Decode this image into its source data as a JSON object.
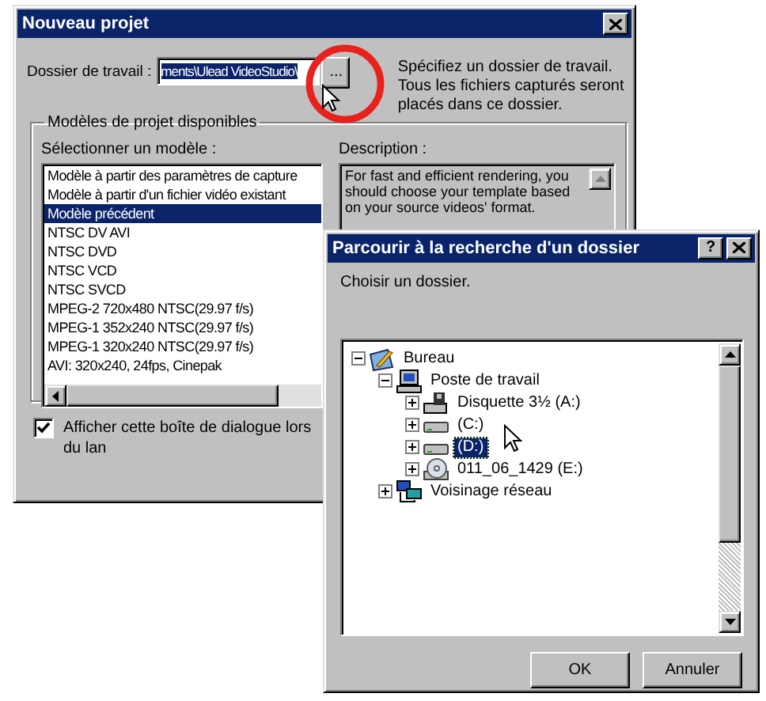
{
  "project_dialog": {
    "title": "Nouveau projet",
    "folder_label": "Dossier de travail :",
    "folder_value": "ments\\Ulead VideoStudio\\",
    "folder_value_selected": true,
    "browse_button": "...",
    "folder_hint": "Spécifiez un dossier de travail. Tous les fichiers capturés seront placés dans ce dossier.",
    "templates_group": "Modèles de projet disponibles",
    "select_label": "Sélectionner un modèle :",
    "templates": [
      {
        "label": "Modèle à partir des paramètres de capture",
        "selected": false
      },
      {
        "label": "Modèle à partir d'un fichier vidéo existant",
        "selected": false
      },
      {
        "label": "Modèle précédent",
        "selected": true
      },
      {
        "label": "NTSC DV AVI",
        "selected": false
      },
      {
        "label": "NTSC DVD",
        "selected": false
      },
      {
        "label": "NTSC VCD",
        "selected": false
      },
      {
        "label": "NTSC SVCD",
        "selected": false
      },
      {
        "label": "MPEG-2 720x480 NTSC(29.97 f/s)",
        "selected": false
      },
      {
        "label": "MPEG-1 352x240 NTSC(29.97 f/s)",
        "selected": false
      },
      {
        "label": "MPEG-1 320x240 NTSC(29.97 f/s)",
        "selected": false
      },
      {
        "label": "AVI: 320x240, 24fps, Cinepak",
        "selected": false
      }
    ],
    "description_label": "Description :",
    "description": "For fast and efficient rendering, you should choose your template based on your source videos' format.",
    "show_dialog": {
      "label": "Afficher cette boîte de dialogue lors du lan",
      "checked": true
    }
  },
  "browse_dialog": {
    "title": "Parcourir à la recherche d'un dossier",
    "help_button": "?",
    "prompt": "Choisir un dossier.",
    "tree": [
      {
        "label": "Bureau",
        "kind": "desktop",
        "expanded": true,
        "selected": false,
        "children": [
          {
            "label": "Poste de travail",
            "kind": "computer",
            "expanded": true,
            "selected": false,
            "children": [
              {
                "label": "Disquette 3½ (A:)",
                "kind": "floppy",
                "expanded": false,
                "selected": false
              },
              {
                "label": "(C:)",
                "kind": "drive",
                "expanded": false,
                "selected": false
              },
              {
                "label": "(D:)",
                "kind": "drive",
                "expanded": false,
                "selected": true
              },
              {
                "label": "011_06_1429 (E:)",
                "kind": "cd",
                "expanded": false,
                "selected": false
              }
            ]
          },
          {
            "label": "Voisinage réseau",
            "kind": "network",
            "expanded": false,
            "selected": false
          }
        ]
      }
    ],
    "buttons": [
      "OK",
      "Annuler"
    ]
  }
}
